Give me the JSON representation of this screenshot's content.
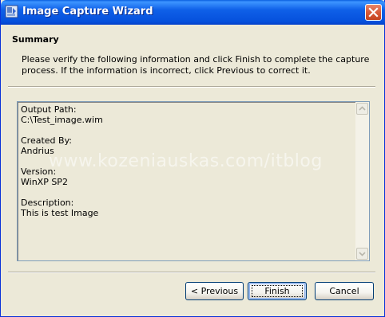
{
  "window": {
    "title": "Image Capture Wizard"
  },
  "header": {
    "title": "Summary",
    "instructions": "Please verify the following information and click Finish to complete the capture process. If the information is incorrect, click Previous to correct it."
  },
  "info": {
    "output_path_label": "Output Path:",
    "output_path_value": "C:\\Test_image.wim",
    "created_by_label": "Created By:",
    "created_by_value": "Andrius",
    "version_label": "Version:",
    "version_value": "WinXP SP2",
    "description_label": "Description:",
    "description_value": "This is test Image"
  },
  "watermark": "www.kozeniauskas.com/itblog",
  "buttons": {
    "previous": "< Previous",
    "finish": "Finish",
    "cancel": "Cancel"
  },
  "colors": {
    "titlebar": "#0550dc",
    "dialog_bg": "#ece9d8",
    "close_button": "#d85a3a"
  },
  "icons": {
    "app": "wizard-app-icon",
    "close": "close-icon",
    "scroll_up": "scroll-up-arrow-icon",
    "scroll_down": "scroll-down-arrow-icon"
  }
}
